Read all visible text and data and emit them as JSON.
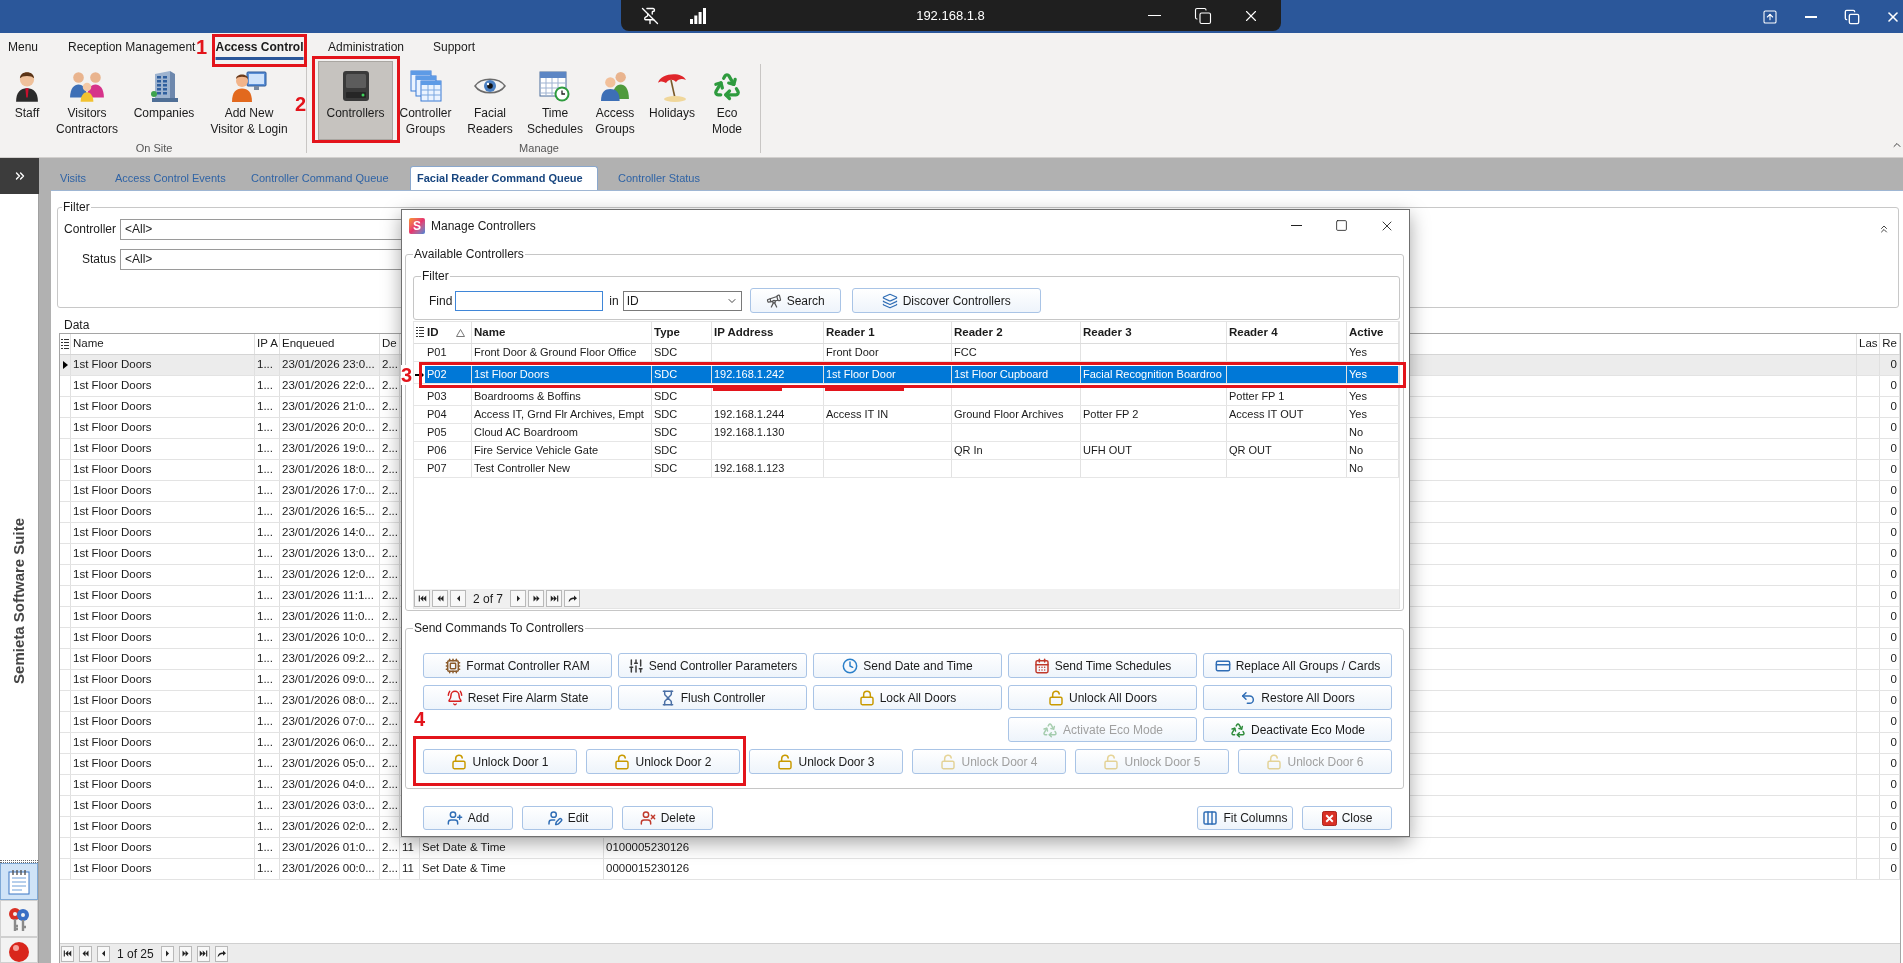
{
  "title_bar": {
    "remote_host": "192.168.1.8"
  },
  "menu_tabs": [
    {
      "label": "Menu",
      "selected": false
    },
    {
      "label": "Reception Management",
      "selected": false
    },
    {
      "label": "Access Control",
      "selected": true,
      "callout": "1"
    },
    {
      "label": "Administration",
      "selected": false
    },
    {
      "label": "Support",
      "selected": false
    }
  ],
  "ribbon_groups": [
    {
      "label": "On Site",
      "items": [
        {
          "lines": [
            "Staff"
          ],
          "selected": false
        },
        {
          "lines": [
            "Visitors",
            "Contractors"
          ],
          "selected": false
        },
        {
          "lines": [
            "Companies"
          ],
          "selected": false
        },
        {
          "lines": [
            "Add New",
            "Visitor & Login"
          ],
          "selected": false
        }
      ]
    },
    {
      "label": "Manage",
      "items": [
        {
          "lines": [
            "Controllers"
          ],
          "selected": true,
          "callout": "2"
        },
        {
          "lines": [
            "Controller",
            "Groups"
          ],
          "selected": false
        },
        {
          "lines": [
            "Facial",
            "Readers"
          ],
          "selected": false
        },
        {
          "lines": [
            "Time",
            "Schedules"
          ],
          "selected": false
        },
        {
          "lines": [
            "Access",
            "Groups"
          ],
          "selected": false
        },
        {
          "lines": [
            "Holidays"
          ],
          "selected": false
        },
        {
          "lines": [
            "Eco",
            "Mode"
          ],
          "selected": false
        }
      ]
    }
  ],
  "sidebar": {
    "title": "Semieta Software Suite",
    "buttons": [
      {
        "selected": true
      },
      {
        "selected": false
      },
      {
        "selected": false
      }
    ]
  },
  "view_tabs": [
    {
      "label": "Visits",
      "selected": false
    },
    {
      "label": "Access Control Events",
      "selected": false
    },
    {
      "label": "Controller Command Queue",
      "selected": false
    },
    {
      "label": "Facial Reader Command Queue",
      "selected": true
    },
    {
      "label": "Controller Status",
      "selected": false
    }
  ],
  "filter": {
    "title": "Filter",
    "fields": [
      {
        "label": "Controller",
        "value": "<All>"
      },
      {
        "label": "Status",
        "value": "<All>"
      }
    ]
  },
  "data_grid": {
    "title": "Data",
    "columns": {
      "name": "Name",
      "column_2": "IP A",
      "enqueued": "Enqueued",
      "column_4": "De",
      "column_8": "Las",
      "column_9": "Re"
    },
    "rows": [
      {
        "selected": true,
        "name": "1st Floor Doors",
        "column_2": "1...",
        "enqueued": "23/01/2026 23:0...",
        "column_4": "2...",
        "column_9": "0"
      },
      {
        "selected": false,
        "name": "1st Floor Doors",
        "column_2": "1...",
        "enqueued": "23/01/2026 22:0...",
        "column_4": "2...",
        "column_9": "0"
      },
      {
        "selected": false,
        "name": "1st Floor Doors",
        "column_2": "1...",
        "enqueued": "23/01/2026 21:0...",
        "column_4": "2...",
        "column_9": "0"
      },
      {
        "selected": false,
        "name": "1st Floor Doors",
        "column_2": "1...",
        "enqueued": "23/01/2026 20:0...",
        "column_4": "2...",
        "column_9": "0"
      },
      {
        "selected": false,
        "name": "1st Floor Doors",
        "column_2": "1...",
        "enqueued": "23/01/2026 19:0...",
        "column_4": "2...",
        "column_9": "0"
      },
      {
        "selected": false,
        "name": "1st Floor Doors",
        "column_2": "1...",
        "enqueued": "23/01/2026 18:0...",
        "column_4": "2...",
        "column_9": "0"
      },
      {
        "selected": false,
        "name": "1st Floor Doors",
        "column_2": "1...",
        "enqueued": "23/01/2026 17:0...",
        "column_4": "2...",
        "column_9": "0"
      },
      {
        "selected": false,
        "name": "1st Floor Doors",
        "column_2": "1...",
        "enqueued": "23/01/2026 16:5...",
        "column_4": "2...",
        "column_9": "0"
      },
      {
        "selected": false,
        "name": "1st Floor Doors",
        "column_2": "1...",
        "enqueued": "23/01/2026 14:0...",
        "column_4": "2...",
        "column_9": "0"
      },
      {
        "selected": false,
        "name": "1st Floor Doors",
        "column_2": "1...",
        "enqueued": "23/01/2026 13:0...",
        "column_4": "2...",
        "column_9": "0"
      },
      {
        "selected": false,
        "name": "1st Floor Doors",
        "column_2": "1...",
        "enqueued": "23/01/2026 12:0...",
        "column_4": "2...",
        "column_9": "0"
      },
      {
        "selected": false,
        "name": "1st Floor Doors",
        "column_2": "1...",
        "enqueued": "23/01/2026 11:1...",
        "column_4": "2...",
        "column_9": "0"
      },
      {
        "selected": false,
        "name": "1st Floor Doors",
        "column_2": "1...",
        "enqueued": "23/01/2026 11:0...",
        "column_4": "2...",
        "column_9": "0"
      },
      {
        "selected": false,
        "name": "1st Floor Doors",
        "column_2": "1...",
        "enqueued": "23/01/2026 10:0...",
        "column_4": "2...",
        "column_9": "0"
      },
      {
        "selected": false,
        "name": "1st Floor Doors",
        "column_2": "1...",
        "enqueued": "23/01/2026 09:2...",
        "column_4": "2...",
        "column_9": "0"
      },
      {
        "selected": false,
        "name": "1st Floor Doors",
        "column_2": "1...",
        "enqueued": "23/01/2026 09:0...",
        "column_4": "2...",
        "column_9": "0"
      },
      {
        "selected": false,
        "name": "1st Floor Doors",
        "column_2": "1...",
        "enqueued": "23/01/2026 08:0...",
        "column_4": "2...",
        "column_9": "0"
      },
      {
        "selected": false,
        "name": "1st Floor Doors",
        "column_2": "1...",
        "enqueued": "23/01/2026 07:0...",
        "column_4": "2...",
        "column_9": "0"
      },
      {
        "selected": false,
        "name": "1st Floor Doors",
        "column_2": "1...",
        "enqueued": "23/01/2026 06:0...",
        "column_4": "2...",
        "column_9": "0"
      },
      {
        "selected": false,
        "name": "1st Floor Doors",
        "column_2": "1...",
        "enqueued": "23/01/2026 05:0...",
        "column_4": "2...",
        "column_9": "0"
      },
      {
        "selected": false,
        "name": "1st Floor Doors",
        "column_2": "1...",
        "enqueued": "23/01/2026 04:0...",
        "column_4": "2...",
        "column_9": "0"
      },
      {
        "selected": false,
        "name": "1st Floor Doors",
        "column_2": "1...",
        "enqueued": "23/01/2026 03:0...",
        "column_4": "2...",
        "column_9": "0"
      },
      {
        "selected": false,
        "name": "1st Floor Doors",
        "column_2": "1...",
        "enqueued": "23/01/2026 02:0...",
        "column_4": "2...",
        "column_9": "0"
      },
      {
        "selected": false,
        "name": "1st Floor Doors",
        "column_2": "1...",
        "enqueued": "23/01/2026 01:0...",
        "column_4": "2...",
        "column_5": "11",
        "column_6": "Set Date & Time",
        "column_7": "0100005230126",
        "column_9": "0"
      },
      {
        "selected": false,
        "name": "1st Floor Doors",
        "column_2": "1...",
        "enqueued": "23/01/2026 00:0...",
        "column_4": "2...",
        "column_5": "11",
        "column_6": "Set Date & Time",
        "column_7": "0000015230126",
        "column_9": "0"
      }
    ],
    "pager": "1 of 25"
  },
  "dialog": {
    "logo": "S",
    "title": "Manage Controllers",
    "available": {
      "title": "Available Controllers",
      "filter": {
        "title": "Filter",
        "find_label": "Find",
        "in_label": "in",
        "search_field": "ID",
        "search_button": "Search",
        "discover_button": "Discover Controllers"
      },
      "grid": {
        "columns": [
          {
            "label": "ID",
            "sorted": true,
            "ascending": true
          },
          {
            "label": "Name",
            "sorted": false
          },
          {
            "label": "Type",
            "sorted": false
          },
          {
            "label": "IP Address",
            "sorted": false
          },
          {
            "label": "Reader 1",
            "sorted": false
          },
          {
            "label": "Reader 2",
            "sorted": false
          },
          {
            "label": "Reader 3",
            "sorted": false
          },
          {
            "label": "Reader 4",
            "sorted": false
          },
          {
            "label": "Active",
            "sorted": false
          }
        ],
        "rows": [
          {
            "selected": false,
            "id": "P01",
            "name": "Front Door & Ground Floor Office",
            "type": "SDC",
            "reader_1": "Front Door",
            "reader_2": "FCC",
            "active": "Yes"
          },
          {
            "selected": true,
            "callout": "3",
            "underlined": {
              "ip_address": true,
              "reader_1": true
            },
            "id": "P02",
            "name": "1st Floor Doors",
            "type": "SDC",
            "ip_address": "192.168.1.242",
            "reader_1": "1st Floor Door",
            "reader_2": "1st Floor Cupboard",
            "reader_3": "Facial Recognition Boardroo",
            "active": "Yes"
          },
          {
            "selected": false,
            "id": "P03",
            "name": "Boardrooms & Boffins",
            "type": "SDC",
            "reader_4": "Potter FP 1",
            "active": "Yes"
          },
          {
            "selected": false,
            "id": "P04",
            "name": "Access IT, Grnd Flr Archives, Empt",
            "type": "SDC",
            "ip_address": "192.168.1.244",
            "reader_1": "Access IT IN",
            "reader_2": "Ground Floor Archives",
            "reader_3": "Potter FP 2",
            "reader_4": "Access IT OUT",
            "active": "Yes"
          },
          {
            "selected": false,
            "id": "P05",
            "name": "Cloud AC Boardroom",
            "type": "SDC",
            "ip_address": "192.168.1.130",
            "active": "No"
          },
          {
            "selected": false,
            "id": "P06",
            "name": "Fire Service Vehicle Gate",
            "type": "SDC",
            "reader_2": "QR In",
            "reader_3": "UFH OUT",
            "reader_4": "QR OUT",
            "active": "No"
          },
          {
            "selected": false,
            "id": "P07",
            "name": "Test Controller New",
            "type": "SDC",
            "ip_address": "192.168.1.123",
            "active": "No"
          }
        ],
        "pager": "2 of 7"
      }
    },
    "commands": {
      "title": "Send Commands To Controllers",
      "rows": [
        {
          "buttons": [
            {
              "label": "Format Controller RAM",
              "disabled": false
            },
            {
              "label": "Send Controller Parameters",
              "disabled": false
            },
            {
              "label": "Send Date and Time",
              "disabled": false
            },
            {
              "label": "Send Time Schedules",
              "disabled": false
            },
            {
              "label": "Replace All Groups / Cards",
              "disabled": false
            }
          ]
        },
        {
          "buttons": [
            {
              "label": "Reset Fire Alarm State",
              "disabled": false
            },
            {
              "label": "Flush Controller",
              "disabled": false
            },
            {
              "label": "Lock All Doors",
              "disabled": false
            },
            {
              "label": "Unlock All Doors",
              "disabled": false
            },
            {
              "label": "Restore All Doors",
              "disabled": false
            }
          ]
        },
        {
          "buttons": [
            {
              "label": "Activate Eco Mode",
              "disabled": true
            },
            {
              "label": "Deactivate Eco Mode",
              "disabled": false
            }
          ]
        },
        {
          "callout": "4",
          "buttons": [
            {
              "label": "Unlock Door 1",
              "disabled": false,
              "in_callout": true
            },
            {
              "label": "Unlock Door 2",
              "disabled": false,
              "in_callout": true
            },
            {
              "label": "Unlock Door 3",
              "disabled": false,
              "in_callout": false
            },
            {
              "label": "Unlock Door 4",
              "disabled": true,
              "in_callout": false
            },
            {
              "label": "Unlock Door 5",
              "disabled": true,
              "in_callout": false
            },
            {
              "label": "Unlock Door 6",
              "disabled": true,
              "in_callout": false
            }
          ]
        }
      ]
    },
    "footer_left": [
      {
        "label": "Add"
      },
      {
        "label": "Edit"
      },
      {
        "label": "Delete"
      }
    ],
    "footer_right": [
      {
        "label": "Fit Columns"
      },
      {
        "label": "Close"
      }
    ]
  }
}
